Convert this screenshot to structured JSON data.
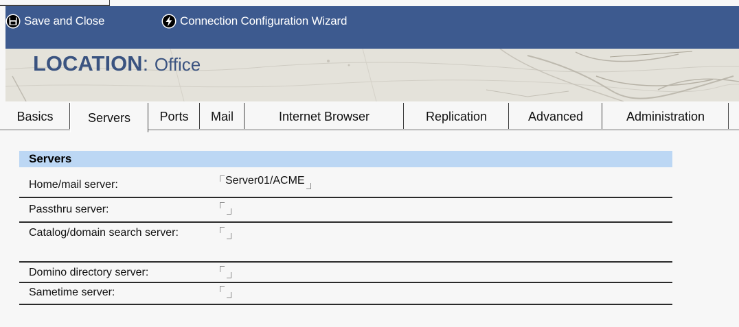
{
  "toolbar": {
    "save_close_label": "Save and Close",
    "wizard_label": "Connection Configuration Wizard"
  },
  "banner": {
    "title_prefix": "LOCATION",
    "title_separator": ":",
    "title_location": "Office"
  },
  "tabs": [
    {
      "label": "Basics"
    },
    {
      "label": "Servers"
    },
    {
      "label": "Ports"
    },
    {
      "label": "Mail"
    },
    {
      "label": "Internet Browser"
    },
    {
      "label": "Replication"
    },
    {
      "label": "Advanced"
    },
    {
      "label": "Administration"
    }
  ],
  "active_tab": "Servers",
  "section": {
    "title": "Servers",
    "rows": [
      {
        "label": "Home/mail server:",
        "value": "Server01/ACME"
      },
      {
        "label": "Passthru server:",
        "value": ""
      },
      {
        "label": "Catalog/domain search server:",
        "value": ""
      },
      {
        "label": "Domino directory server:",
        "value": ""
      },
      {
        "label": "Sametime server:",
        "value": ""
      }
    ]
  },
  "colors": {
    "toolbar_bg": "#3d5a8f",
    "title_color": "#3a5380",
    "section_header_bg": "#bcd7f4"
  },
  "icons": {
    "save_close": "floppy-disk-icon",
    "wizard": "lightning-bolt-icon"
  }
}
